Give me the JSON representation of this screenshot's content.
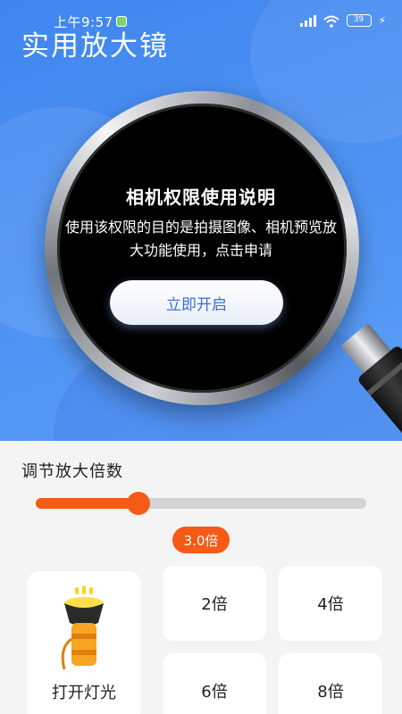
{
  "status_bar": {
    "time": "上午9:57",
    "battery": "39",
    "icons": [
      "app-notification-icon",
      "hd-signal-icon",
      "wifi-icon",
      "battery-icon",
      "charging-bolt-icon"
    ]
  },
  "header": {
    "title": "实用放大镜"
  },
  "permission": {
    "title": "相机权限使用说明",
    "description": "使用该权限的目的是拍摄图像、相机预览放大功能使用，点击申请",
    "button_label": "立即开启"
  },
  "zoom": {
    "label": "调节放大倍数",
    "value_label": "3.0倍",
    "slider_fraction": 0.31
  },
  "light": {
    "label": "打开灯光",
    "icon": "flashlight-icon"
  },
  "presets": [
    {
      "label": "2倍"
    },
    {
      "label": "4倍"
    },
    {
      "label": "6倍"
    },
    {
      "label": "8倍"
    }
  ],
  "colors": {
    "accent": "#f55a16",
    "hero_blue": "#4b90f2",
    "button_text": "#3a6fd8"
  }
}
